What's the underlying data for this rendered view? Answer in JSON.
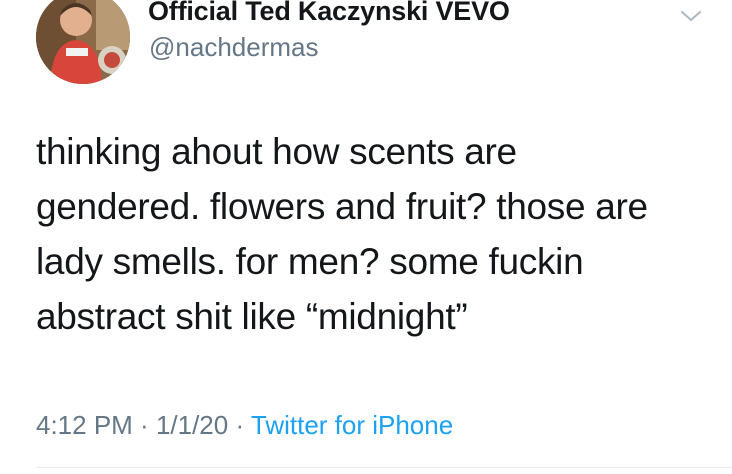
{
  "author": {
    "display_name": "Official Ted Kaczynski VEVO",
    "handle": "@nachdermas",
    "avatar_icon": "profile-photo-icon"
  },
  "menu_icon": "chevron-down-icon",
  "tweet": {
    "lines": [
      "thinking ahout how scents are",
      "gendered. flowers and fruit? those are",
      "lady smells. for men? some fuckin",
      "abstract shit like “midnight”"
    ]
  },
  "meta": {
    "time": "4:12 PM",
    "separator": " · ",
    "date": "1/1/20",
    "source": "Twitter for iPhone"
  },
  "colors": {
    "text": "#14171a",
    "secondary": "#657786",
    "link": "#1da1f2",
    "divider": "#e6ecf0"
  }
}
